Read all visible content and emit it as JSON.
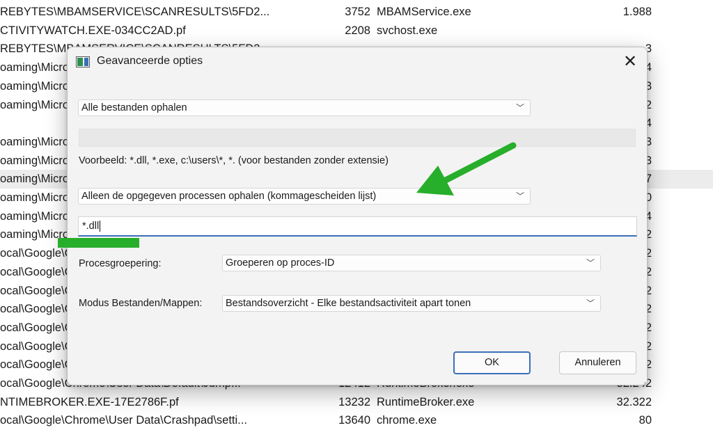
{
  "background_rows": [
    {
      "path": "REBYTES\\MBAMSERVICE\\SCANRESULTS\\5FD2...",
      "pid": "3752",
      "process": "MBAMService.exe",
      "value": "1.988",
      "tail": ""
    },
    {
      "path": "CTIVITYWATCH.EXE-034CC2AD.pf",
      "pid": "2208",
      "process": "svchost.exe",
      "value": "",
      "tail": ""
    },
    {
      "path": "REBYTES\\MBAMSERVICE\\SCANRESULTS\\5FD2...",
      "pid": "",
      "process": "",
      "value": "",
      "tail": "3"
    },
    {
      "path": "oaming\\Microsoft",
      "pid": "",
      "process": "",
      "value": "",
      "tail": "4"
    },
    {
      "path": "oaming\\Microsoft",
      "pid": "",
      "process": "",
      "value": "",
      "tail": "3"
    },
    {
      "path": "oaming\\Microsoft",
      "pid": "",
      "process": "",
      "value": "",
      "tail": "2"
    },
    {
      "path": "",
      "pid": "",
      "process": "",
      "value": "",
      "tail": "4"
    },
    {
      "path": "oaming\\Microsoft",
      "pid": "",
      "process": "",
      "value": "",
      "tail": "3"
    },
    {
      "path": "oaming\\Microsoft",
      "pid": "",
      "process": "",
      "value": "",
      "tail": "3"
    },
    {
      "path": "oaming\\Microsoft",
      "pid": "",
      "process": "",
      "value": "",
      "tail": "7"
    },
    {
      "path": "oaming\\Microsoft",
      "pid": "",
      "process": "",
      "value": "",
      "tail": "0"
    },
    {
      "path": "oaming\\Microsoft",
      "pid": "",
      "process": "",
      "value": "",
      "tail": "4"
    },
    {
      "path": "oaming\\Microsoft",
      "pid": "",
      "process": "",
      "value": "",
      "tail": "2"
    },
    {
      "path": "ocal\\Google\\Chrome",
      "pid": "",
      "process": "",
      "value": "",
      "tail": "2"
    },
    {
      "path": "ocal\\Google\\Chrome",
      "pid": "",
      "process": "",
      "value": "",
      "tail": "2"
    },
    {
      "path": "ocal\\Google\\Chrome",
      "pid": "",
      "process": "",
      "value": "",
      "tail": "2"
    },
    {
      "path": "ocal\\Google\\Chrome",
      "pid": "",
      "process": "",
      "value": "",
      "tail": "2"
    },
    {
      "path": "ocal\\Google\\Chrome",
      "pid": "",
      "process": "",
      "value": "",
      "tail": "2"
    },
    {
      "path": "ocal\\Google\\Chrome",
      "pid": "",
      "process": "",
      "value": "",
      "tail": "2"
    },
    {
      "path": "ocal\\Google\\Chrome",
      "pid": "",
      "process": "",
      "value": "",
      "tail": "2"
    },
    {
      "path": "ocal\\Google\\Chrome\\User Data\\Default\\Jump...",
      "pid": "12412",
      "process": "RuntimeBroker.exe",
      "value": "32.242",
      "tail": ""
    },
    {
      "path": "NTIMEBROKER.EXE-17E2786F.pf",
      "pid": "13232",
      "process": "RuntimeBroker.exe",
      "value": "32.322",
      "tail": ""
    },
    {
      "path": "ocal\\Google\\Chrome\\User Data\\Crashpad\\setti...",
      "pid": "13640",
      "process": "chrome.exe",
      "value": "80",
      "tail": ""
    }
  ],
  "dialog": {
    "title": "Geavanceerde opties",
    "close_glyph": "✕",
    "file_filter_select": "Alle bestanden ophalen",
    "example_text": "Voorbeeld: *.dll, *.exe, c:\\users\\*, *. (voor bestanden zonder extensie)",
    "process_filter_select": "Alleen de opgegeven processen ophalen (kommagescheiden lijst)",
    "process_input_value": "*.dll",
    "grouping_label": "Procesgroepering:",
    "grouping_select": "Groeperen op proces-ID",
    "mode_label": "Modus Bestanden/Mappen:",
    "mode_select": "Bestandsoverzicht - Elke bestandsactiviteit apart tonen",
    "ok_label": "OK",
    "cancel_label": "Annuleren"
  },
  "annotation_color": "#27ae2b",
  "icons": {
    "chevron": "chevron-down-icon",
    "close": "close-icon",
    "app": "app-icon",
    "arrow": "green-arrow-annotation"
  }
}
